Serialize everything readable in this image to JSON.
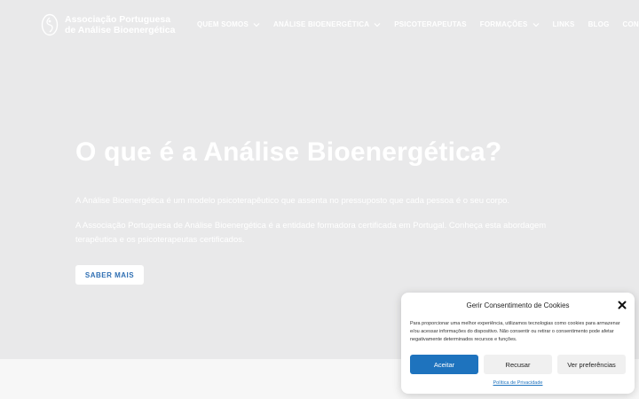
{
  "header": {
    "logo_line1": "Associação Portuguesa",
    "logo_line2": "de Análise Bioenergética",
    "nav": [
      {
        "label": "QUEM SOMOS",
        "has_dropdown": true
      },
      {
        "label": "ANÁLISE BIOENERGÉTICA",
        "has_dropdown": true
      },
      {
        "label": "PSICOTERAPEUTAS",
        "has_dropdown": false
      },
      {
        "label": "FORMAÇÕES",
        "has_dropdown": true
      },
      {
        "label": "LINKS",
        "has_dropdown": false
      },
      {
        "label": "BLOG",
        "has_dropdown": false
      },
      {
        "label": "CONTACTOS",
        "has_dropdown": false
      }
    ]
  },
  "hero": {
    "title": "O que é a Análise Bioenergética?",
    "paragraph1": "A Análise Bioenergética é um modelo psicoterapêutico que assenta no pressuposto que cada pessoa é o seu corpo.",
    "paragraph2": "A Associação Portuguesa de Análise Bioenergética é a entidade formadora certificada em Portugal. Conheça esta abordagem terapêutica e os psicoterapeutas certificados.",
    "cta_label": "SABER MAIS"
  },
  "cookie_modal": {
    "title": "Gerir Consentimento de Cookies",
    "text": "Para proporcionar uma melhor experiência, utilizamos tecnologias como cookies para armazenar e/ou acessar informações do dispositivo. Não consentir ou retirar o consentimento pode afetar negativamente determinados recursos e funções.",
    "accept_label": "Aceitar",
    "deny_label": "Recusar",
    "prefs_label": "Ver preferências",
    "policy_link": "Política de Privacidade"
  },
  "colors": {
    "hero_bg": "#e9e9ea",
    "accent": "#1e73be",
    "cta_text": "#2f6fb3"
  },
  "icons": {
    "logo": "circle-emblem-icon",
    "dropdown": "chevron-down-icon",
    "close": "close-icon"
  }
}
